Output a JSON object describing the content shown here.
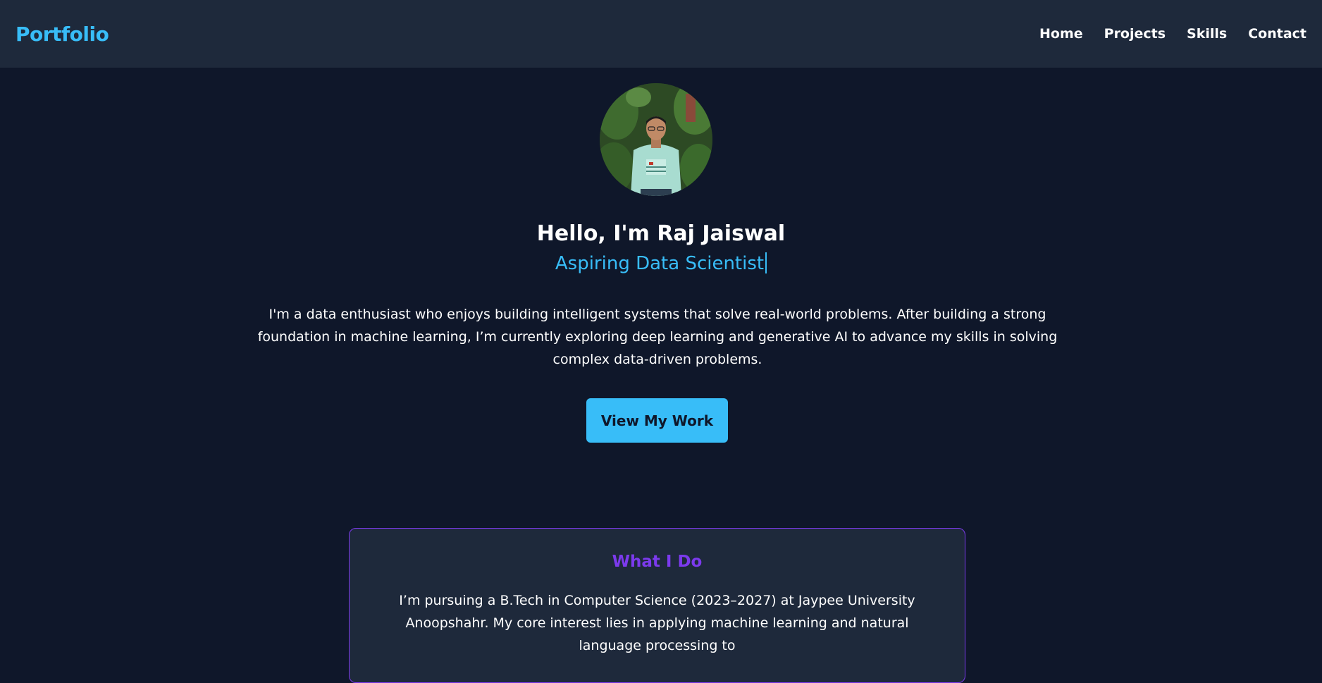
{
  "navbar": {
    "brand": "Portfolio",
    "links": [
      "Home",
      "Projects",
      "Skills",
      "Contact"
    ]
  },
  "hero": {
    "avatar_alt": "Profile photo of Raj Jaiswal",
    "title": "Hello, I'm Raj Jaiswal",
    "subtitle": "Aspiring Data Scientist",
    "description": "I'm a data enthusiast who enjoys building intelligent systems that solve real-world problems. After building a strong foundation in machine learning, I’m currently exploring deep learning and generative AI to advance my skills in solving complex data-driven problems.",
    "cta_label": "View My Work"
  },
  "about": {
    "title": "What I Do",
    "text": "I’m pursuing a B.Tech in Computer Science (2023–2027) at Jaypee University Anoopshahr. My core interest lies in applying machine learning and natural language processing to"
  },
  "colors": {
    "background": "#0f172a",
    "navbar": "#1e293b",
    "accent": "#38bdf8",
    "card_accent": "#7c3aed"
  }
}
